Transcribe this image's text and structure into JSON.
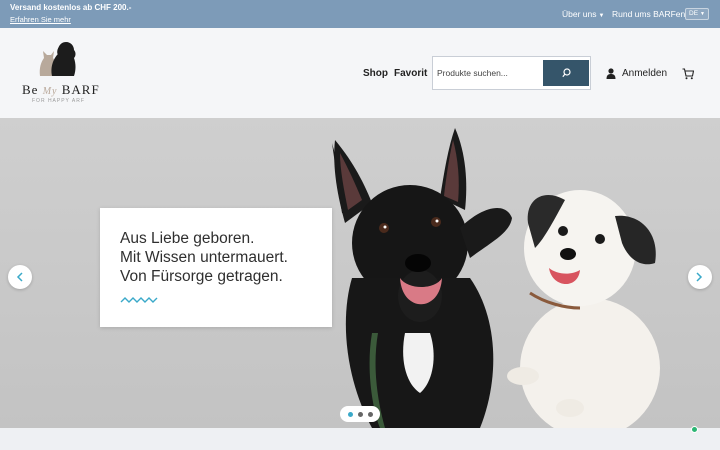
{
  "topbar": {
    "shipping_text": "Versand kostenlos ab CHF 200.-",
    "learn_more": "Erfahren Sie mehr",
    "about_label": "Über uns",
    "barfen_label": "Rund ums BARFen",
    "language": "DE"
  },
  "logo": {
    "brand_left": "Be",
    "brand_my": "My",
    "brand_right": "BARF",
    "tagline": "FOR HAPPY ARF"
  },
  "nav": {
    "shop": "Shop",
    "favorites": "Favorit"
  },
  "search": {
    "placeholder": "Produkte suchen..."
  },
  "account": {
    "login": "Anmelden"
  },
  "hero": {
    "line1": "Aus Liebe geboren.",
    "line2": "Mit Wissen untermauert.",
    "line3": "Von Fürsorge getragen.",
    "slide_count": 3,
    "active_slide": 1
  },
  "colors": {
    "topbar": "#7d9bb8",
    "search_button": "#35556a",
    "accent": "#3aa9c9"
  },
  "icons": {
    "search": "search-icon",
    "user": "user-icon",
    "cart": "cart-icon",
    "prev": "chevron-left-icon",
    "next": "chevron-right-icon"
  }
}
